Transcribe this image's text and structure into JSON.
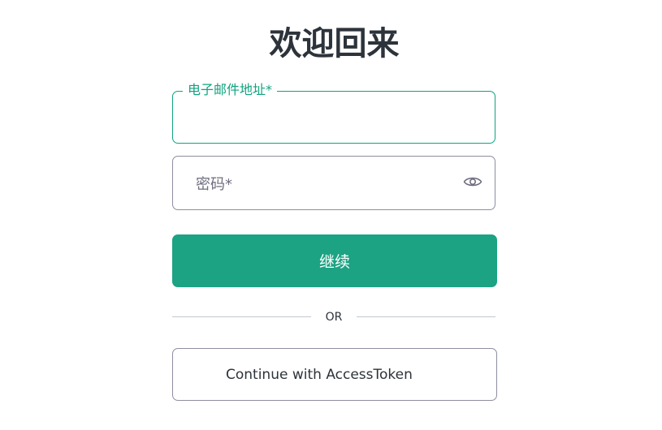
{
  "header": {
    "title": "欢迎回来"
  },
  "form": {
    "email": {
      "label": "电子邮件地址*",
      "value": ""
    },
    "password": {
      "placeholder": "密码*",
      "value": "",
      "toggle_icon": "eye-icon"
    },
    "continue_label": "继续",
    "divider_text": "OR",
    "access_token_label": "Continue with AccessToken"
  },
  "colors": {
    "accent": "#10a37f",
    "button": "#1ba383",
    "text": "#2d333a",
    "border": "#8e8ea0",
    "divider": "#c2c8d0"
  }
}
